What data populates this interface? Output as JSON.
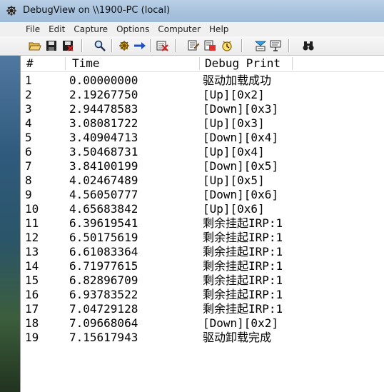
{
  "window": {
    "title": "DebugView on \\\\1900-PC (local)"
  },
  "menu": [
    "File",
    "Edit",
    "Capture",
    "Options",
    "Computer",
    "Help"
  ],
  "toolbar": {
    "icons": [
      "open-folder-icon",
      "save-icon",
      "save-as-icon",
      "find-icon",
      "capture-icon",
      "autoscroll-icon",
      "clear-icon",
      "filter-icon",
      "highlight-icon",
      "history-icon",
      "timestamp-icon",
      "capture-kernel-icon",
      "search-binoculars-icon"
    ]
  },
  "table": {
    "columns": [
      "#",
      "Time",
      "Debug Print"
    ],
    "rows": [
      {
        "num": "1",
        "time": "0.00000000",
        "print": "驱动加载成功"
      },
      {
        "num": "2",
        "time": "2.19267750",
        "print": "[Up][0x2]"
      },
      {
        "num": "3",
        "time": "2.94478583",
        "print": "[Down][0x3]"
      },
      {
        "num": "4",
        "time": "3.08081722",
        "print": "[Up][0x3]"
      },
      {
        "num": "5",
        "time": "3.40904713",
        "print": "[Down][0x4]"
      },
      {
        "num": "6",
        "time": "3.50468731",
        "print": "[Up][0x4]"
      },
      {
        "num": "7",
        "time": "3.84100199",
        "print": "[Down][0x5]"
      },
      {
        "num": "8",
        "time": "4.02467489",
        "print": "[Up][0x5]"
      },
      {
        "num": "9",
        "time": "4.56050777",
        "print": "[Down][0x6]"
      },
      {
        "num": "10",
        "time": "4.65683842",
        "print": "[Up][0x6]"
      },
      {
        "num": "11",
        "time": "6.39619541",
        "print": "剩余挂起IRP:1"
      },
      {
        "num": "12",
        "time": "6.50175619",
        "print": "剩余挂起IRP:1"
      },
      {
        "num": "13",
        "time": "6.61083364",
        "print": "剩余挂起IRP:1"
      },
      {
        "num": "14",
        "time": "6.71977615",
        "print": "剩余挂起IRP:1"
      },
      {
        "num": "15",
        "time": "6.82896709",
        "print": "剩余挂起IRP:1"
      },
      {
        "num": "16",
        "time": "6.93783522",
        "print": "剩余挂起IRP:1"
      },
      {
        "num": "17",
        "time": "7.04729128",
        "print": "剩余挂起IRP:1"
      },
      {
        "num": "18",
        "time": "7.09668064",
        "print": "[Down][0x2]"
      },
      {
        "num": "19",
        "time": "7.15617943",
        "print": "驱动卸载完成"
      }
    ]
  }
}
